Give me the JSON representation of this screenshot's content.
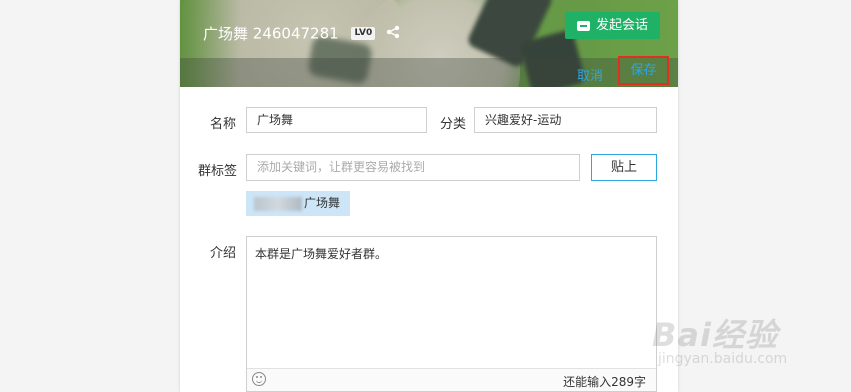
{
  "header": {
    "group_name": "广场舞",
    "group_number": "246047281",
    "level_badge": "LV0",
    "chat_button_label": "发起会话",
    "cancel_label": "取消",
    "save_label": "保存"
  },
  "form": {
    "name_label": "名称",
    "name_value": "广场舞",
    "category_label": "分类",
    "category_value": "兴趣爱好-运动",
    "tags_label": "群标签",
    "tags_placeholder": "添加关键词，让群更容易被找到",
    "paste_button_label": "贴上",
    "tag_text": "广场舞",
    "intro_label": "介绍",
    "intro_value": "本群是广场舞爱好者群。",
    "char_counter": "还能输入289字"
  },
  "watermark": {
    "brand": "Bai经验",
    "url": "jingyan.baidu.com"
  },
  "colors": {
    "accent_blue": "#2ea7e0",
    "chat_green": "#1fb266",
    "highlight_red": "#e0301e",
    "tag_bg": "#cce6f8"
  }
}
